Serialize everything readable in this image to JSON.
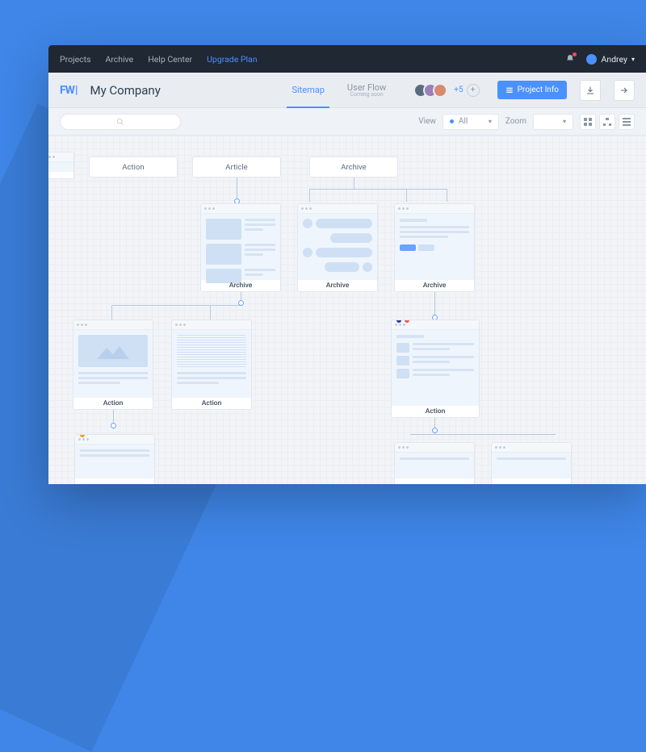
{
  "nav": {
    "projects": "Projects",
    "archive": "Archive",
    "help": "Help Center",
    "upgrade": "Upgrade Plan",
    "user": "Andrey"
  },
  "header": {
    "logo": "FW",
    "company": "My Company",
    "tab_sitemap": "Sitemap",
    "tab_userflow": "User Flow",
    "tab_userflow_sub": "Coming soon",
    "collab_extra": "+5",
    "project_info": "Project Info"
  },
  "toolbar": {
    "view_label": "View",
    "view_value": "All",
    "zoom_label": "Zoom"
  },
  "chips": {
    "c1": "Action",
    "c2": "Article",
    "c3": "Archive"
  },
  "cards": {
    "row1_a": "Archive",
    "row1_b": "Archive",
    "row1_c": "Archive",
    "row2_a": "Action",
    "row2_b": "Action",
    "row2_c": "Action"
  }
}
